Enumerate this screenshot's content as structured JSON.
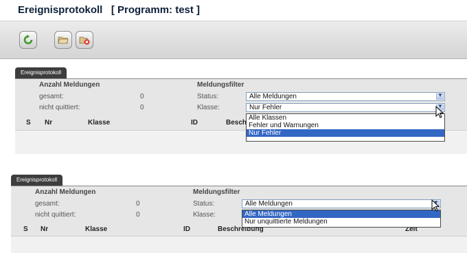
{
  "window": {
    "title": "Ereignisprotokoll   [ Programm: test ]"
  },
  "toolbar": {
    "buttons": [
      "refresh-icon",
      "folder-icon",
      "delete-icon"
    ]
  },
  "colors": {
    "selection": "#3367c4",
    "tab": "#3d3d3d",
    "titleText": "#0d1f3a"
  },
  "panel1": {
    "tab": "Ereignisprotokoll",
    "count_heading": "Anzahl Meldungen",
    "total_label": "gesamt:",
    "total_value": "0",
    "unack_label": "nicht quittiert:",
    "unack_value": "0",
    "filter_heading": "Meldungsfilter",
    "status_label": "Status:",
    "status_value": "Alle Meldungen",
    "class_label": "Klasse:",
    "class_value": "Nur Fehler",
    "columns": [
      "S",
      "Nr",
      "Klasse",
      "ID",
      "Besch"
    ],
    "class_options": [
      "Alle Klassen",
      "Fehler und Warnungen",
      "Nur Fehler"
    ],
    "class_selected": "Nur Fehler"
  },
  "panel2": {
    "tab": "Ereignisprotokoll",
    "count_heading": "Anzahl Meldungen",
    "total_label": "gesamt:",
    "total_value": "0",
    "unack_label": "nicht quittiert:",
    "unack_value": "0",
    "filter_heading": "Meldungsfilter",
    "status_label": "Status:",
    "status_value": "Alle Meldungen",
    "class_label": "Klasse:",
    "columns": [
      "S",
      "Nr",
      "Klasse",
      "ID",
      "Beschreibung",
      "Zeit"
    ],
    "status_options": [
      "Alle Meldungen",
      "Nur unquittierte Meldungen"
    ],
    "status_selected": "Alle Meldungen"
  }
}
